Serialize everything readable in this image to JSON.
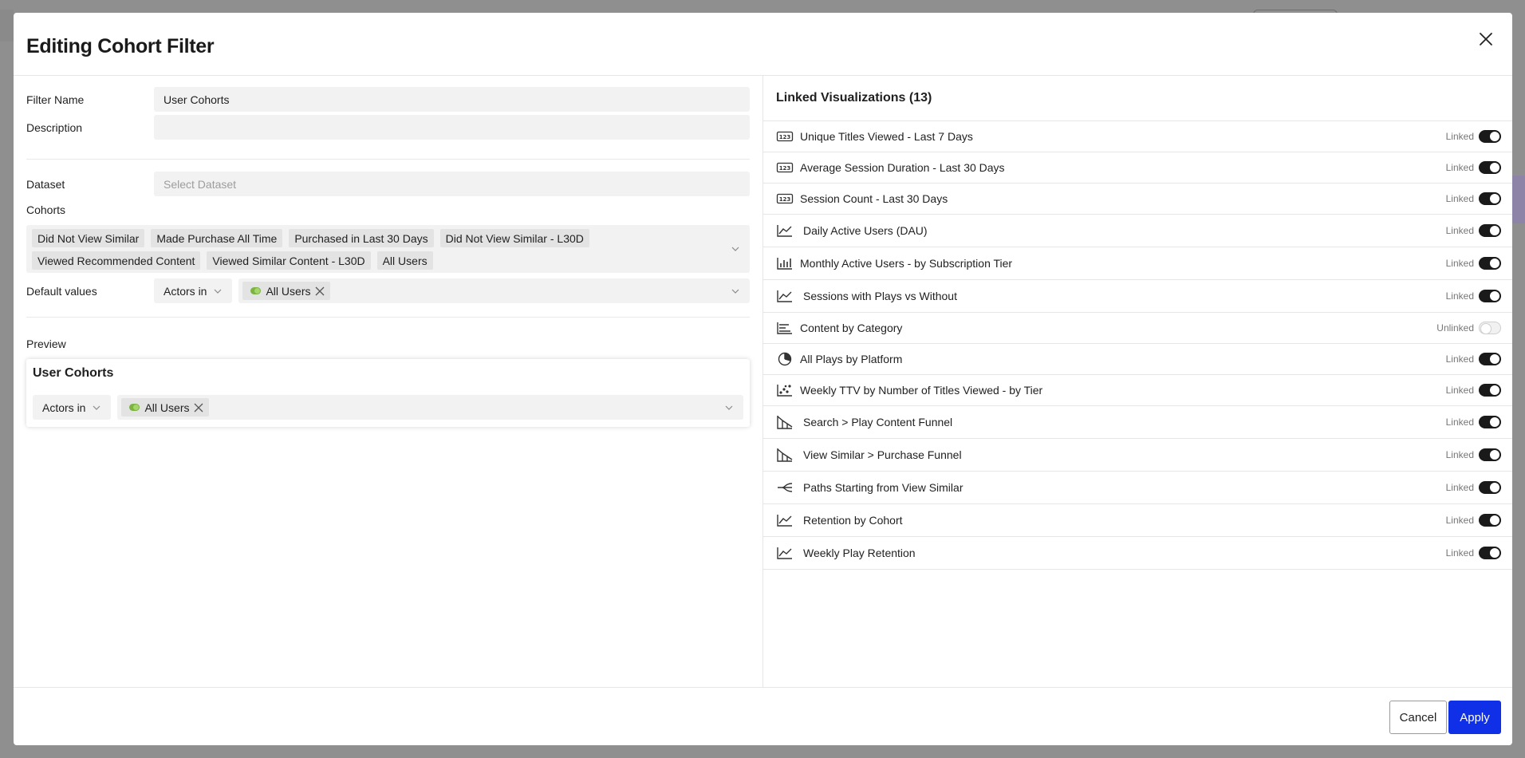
{
  "modal": {
    "title": "Editing Cohort Filter"
  },
  "form": {
    "filter_name_label": "Filter Name",
    "filter_name_value": "User Cohorts",
    "description_label": "Description",
    "description_value": "",
    "dataset_label": "Dataset",
    "dataset_placeholder": "Select Dataset",
    "cohorts_label": "Cohorts",
    "cohorts": [
      "Did Not View Similar",
      "Made Purchase All Time",
      "Purchased in Last 30 Days",
      "Did Not View Similar - L30D",
      "Viewed Recommended Content",
      "Viewed Similar Content - L30D",
      "All Users"
    ],
    "default_values_label": "Default values",
    "operator": "Actors in",
    "default_value_chip": "All Users"
  },
  "preview": {
    "label": "Preview",
    "title": "User Cohorts",
    "operator": "Actors in",
    "value_chip": "All Users"
  },
  "linked": {
    "title": "Linked Visualizations (13)",
    "items": [
      {
        "name": "Unique Titles Viewed - Last 7 Days",
        "icon": "number-icon",
        "status": "Linked",
        "on": true
      },
      {
        "name": "Average Session Duration - Last 30 Days",
        "icon": "number-icon",
        "status": "Linked",
        "on": true
      },
      {
        "name": "Session Count - Last 30 Days",
        "icon": "number-icon",
        "status": "Linked",
        "on": true
      },
      {
        "name": "Daily Active Users (DAU)",
        "icon": "line-chart-icon",
        "status": "Linked",
        "on": true
      },
      {
        "name": "Monthly Active Users - by Subscription Tier",
        "icon": "bar-chart-icon",
        "status": "Linked",
        "on": true
      },
      {
        "name": "Sessions with Plays vs Without",
        "icon": "line-chart-icon",
        "status": "Linked",
        "on": true
      },
      {
        "name": "Content by Category",
        "icon": "horizontal-bar-icon",
        "status": "Unlinked",
        "on": false
      },
      {
        "name": "All Plays by Platform",
        "icon": "pie-chart-icon",
        "status": "Linked",
        "on": true
      },
      {
        "name": "Weekly TTV by Number of Titles Viewed - by Tier",
        "icon": "scatter-icon",
        "status": "Linked",
        "on": true
      },
      {
        "name": "Search > Play Content Funnel",
        "icon": "funnel-icon",
        "status": "Linked",
        "on": true
      },
      {
        "name": "View Similar > Purchase Funnel",
        "icon": "funnel-icon",
        "status": "Linked",
        "on": true
      },
      {
        "name": "Paths Starting from View Similar",
        "icon": "paths-icon",
        "status": "Linked",
        "on": true
      },
      {
        "name": "Retention by Cohort",
        "icon": "line-chart-icon",
        "status": "Linked",
        "on": true
      },
      {
        "name": "Weekly Play Retention",
        "icon": "line-chart-icon",
        "status": "Linked",
        "on": true
      }
    ]
  },
  "footer": {
    "cancel_label": "Cancel",
    "apply_label": "Apply"
  },
  "colors": {
    "apply": "#1030e8",
    "toggle_on": "#1a1a1a",
    "cohort_dot": "#7cb342"
  }
}
